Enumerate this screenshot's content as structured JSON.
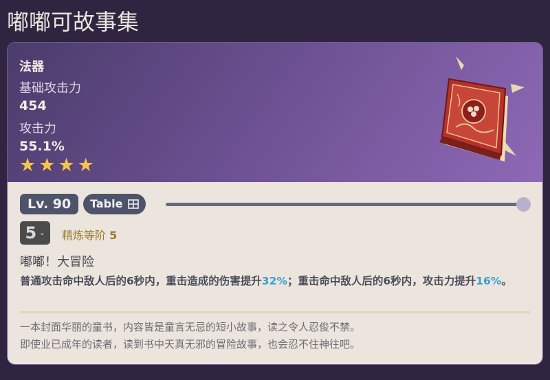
{
  "page": {
    "title": "嘟嘟可故事集"
  },
  "weapon": {
    "type": "法器",
    "base_atk_label": "基础攻击力",
    "base_atk_value": "454",
    "sub_stat_label": "攻击力",
    "sub_stat_value": "55.1%",
    "rarity": 4,
    "icon": "book-catalyst-icon"
  },
  "controls": {
    "level": "Lv. 90",
    "table_label": "Table",
    "table_icon": "table-icon",
    "level_slider_fraction": 1.0,
    "refinement_value": "5",
    "refinement_label": "精炼等阶",
    "refinement_level": "5"
  },
  "passive": {
    "name": "嘟嘟！大冒险",
    "desc_part1": "普通攻击命中敌人后的6秒内，重击造成的伤害提升",
    "desc_hl1": "32%",
    "desc_part2": "；重击命中敌人后的6秒内，攻击力提升",
    "desc_hl2": "16%",
    "desc_part3": "。"
  },
  "flavor": {
    "line1": "一本封面华丽的童书，内容皆是童言无忌的短小故事，读之令人忍俊不禁。",
    "line2": "即使业已成年的读者，读到书中天真无邪的冒险故事，也会忍不住神往吧。"
  },
  "colors": {
    "star": "#f6c44a",
    "highlight": "#3aa0cf",
    "badge": "#4d5469",
    "refine_text": "#9a7a2a"
  }
}
